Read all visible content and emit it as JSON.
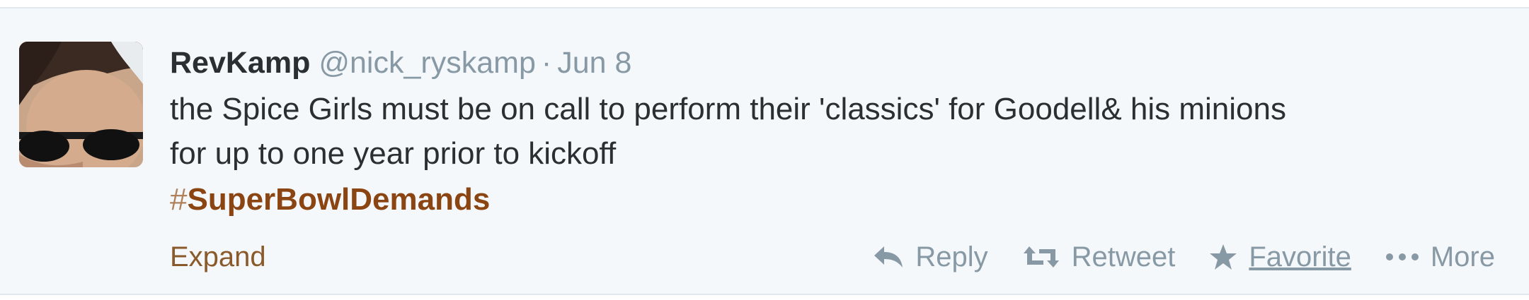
{
  "tweet": {
    "display_name": "RevKamp",
    "handle": "@nick_ryskamp",
    "separator": "·",
    "date": "Jun 8",
    "text_line1": "the Spice Girls must be on call to perform their 'classics' for Goodell& his minions",
    "text_line2": "for up to one year prior to kickoff",
    "hashtag_symbol": "#",
    "hashtag_text": "SuperBowlDemands",
    "expand_label": "Expand",
    "actions": {
      "reply": "Reply",
      "retweet": "Retweet",
      "favorite": "Favorite",
      "more": "More"
    },
    "icons": {
      "reply": "reply-arrow-icon",
      "retweet": "retweet-icon",
      "favorite": "star-icon",
      "more": "ellipsis-icon"
    }
  },
  "colors": {
    "background": "#f5f8fa",
    "name": "#292f33",
    "meta": "#8899a6",
    "hashtag": "#8b4513",
    "expand": "#8b5a2b"
  }
}
